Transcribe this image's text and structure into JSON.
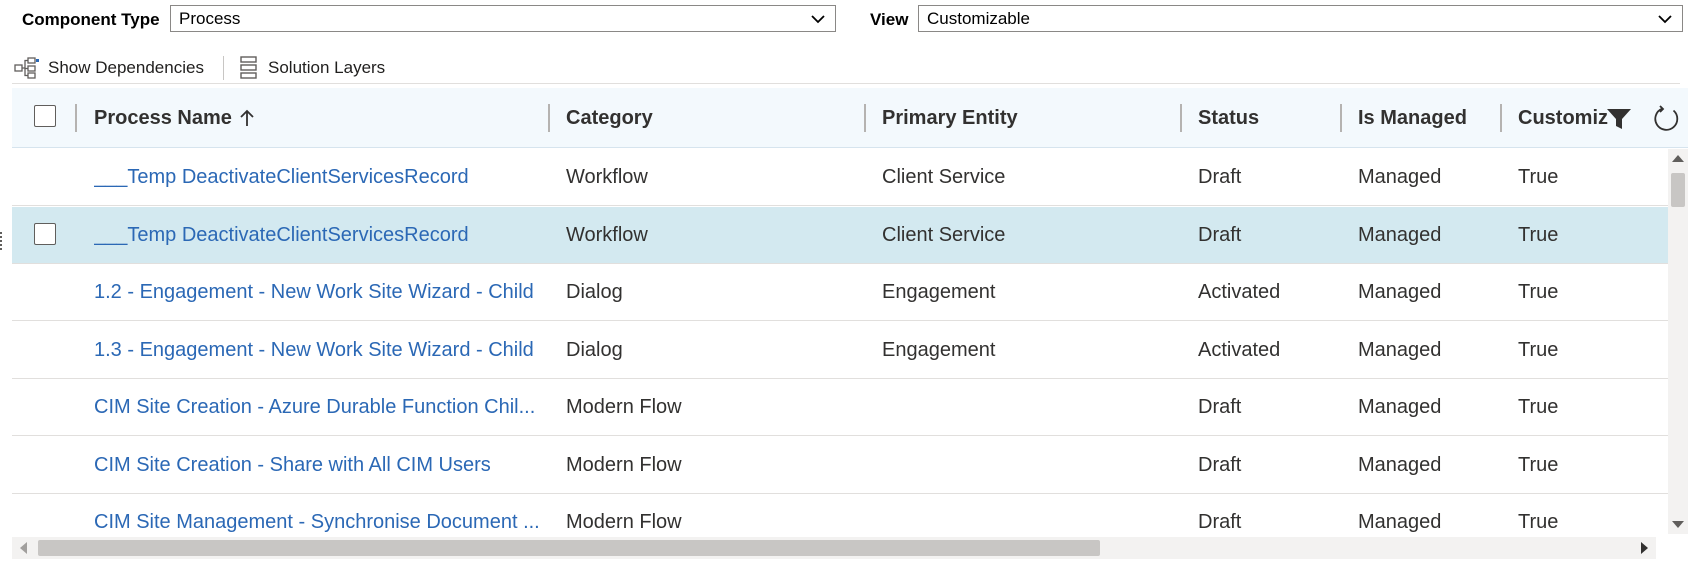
{
  "filters": {
    "component_type_label": "Component Type",
    "component_type_value": "Process",
    "view_label": "View",
    "view_value": "Customizable"
  },
  "commands": {
    "show_dependencies": "Show Dependencies",
    "solution_layers": "Solution Layers"
  },
  "grid": {
    "columns": {
      "name": "Process Name",
      "category": "Category",
      "primary_entity": "Primary Entity",
      "status": "Status",
      "is_managed": "Is Managed",
      "customizable": "Customiz"
    },
    "sort_indicator": "↑",
    "rows": [
      {
        "name": "___Temp DeactivateClientServicesRecord",
        "category": "Workflow",
        "entity": "Client Service",
        "status": "Draft",
        "managed": "Managed",
        "customizable": "True"
      },
      {
        "name": "___Temp DeactivateClientServicesRecord",
        "category": "Workflow",
        "entity": "Client Service",
        "status": "Draft",
        "managed": "Managed",
        "customizable": "True"
      },
      {
        "name": "1.2 - Engagement - New Work Site Wizard - Child",
        "category": "Dialog",
        "entity": "Engagement",
        "status": "Activated",
        "managed": "Managed",
        "customizable": "True"
      },
      {
        "name": "1.3 - Engagement - New Work Site Wizard - Child",
        "category": "Dialog",
        "entity": "Engagement",
        "status": "Activated",
        "managed": "Managed",
        "customizable": "True"
      },
      {
        "name": "CIM Site Creation - Azure Durable Function Chil...",
        "category": "Modern Flow",
        "entity": "",
        "status": "Draft",
        "managed": "Managed",
        "customizable": "True"
      },
      {
        "name": "CIM Site Creation - Share with All CIM Users",
        "category": "Modern Flow",
        "entity": "",
        "status": "Draft",
        "managed": "Managed",
        "customizable": "True"
      },
      {
        "name": "CIM Site Management - Synchronise Document ...",
        "category": "Modern Flow",
        "entity": "",
        "status": "Draft",
        "managed": "Managed",
        "customizable": "True"
      }
    ]
  },
  "icons": {
    "chevron": "chevron-down-icon",
    "dependencies": "dependencies-icon",
    "layers": "solution-layers-icon",
    "filter": "filter-icon",
    "refresh": "refresh-icon",
    "sort": "sort-ascending-icon"
  },
  "colors": {
    "link": "#2b68b5",
    "selected_row": "#d3e9f0",
    "header_bg": "#f3f9fd"
  }
}
